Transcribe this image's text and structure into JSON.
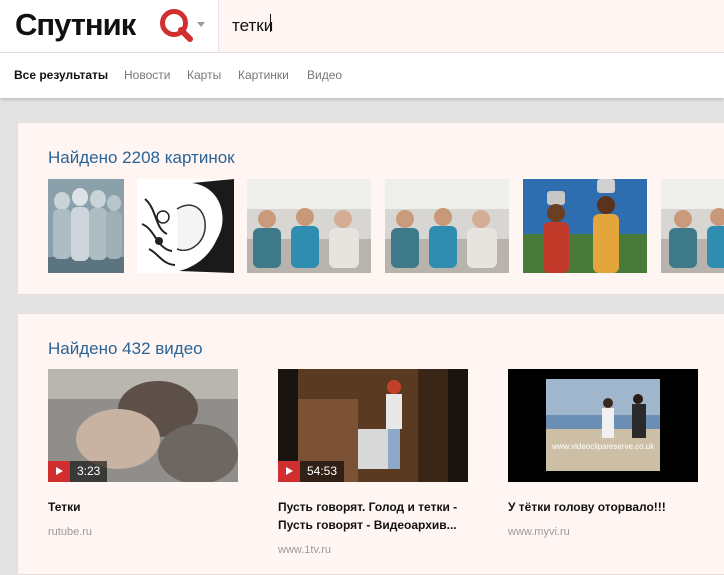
{
  "header": {
    "logo_text": "Спутник",
    "search_value": "тетки"
  },
  "nav": {
    "items": [
      {
        "label": "Все результаты",
        "active": true
      },
      {
        "label": "Новости"
      },
      {
        "label": "Карты"
      },
      {
        "label": "Картинки"
      },
      {
        "label": "Видео"
      }
    ]
  },
  "images_section": {
    "title": "Найдено 2208 картинок",
    "thumbnails": [
      {
        "subject": "sculpture of figures"
      },
      {
        "subject": "ink drawing of a face"
      },
      {
        "subject": "three women on a sofa"
      },
      {
        "subject": "three women on a sofa"
      },
      {
        "subject": "women carrying water pots"
      },
      {
        "subject": "three women on a sofa"
      }
    ]
  },
  "videos_section": {
    "title": "Найдено 432 видео",
    "videos": [
      {
        "duration": "3:23",
        "title": "Тетки",
        "source": "rutube.ru"
      },
      {
        "duration": "54:53",
        "title": "Пусть говорят. Голод и тетки - Пусть говорят - Видеоархив...",
        "source": "www.1tv.ru"
      },
      {
        "duration": "",
        "title": "У тётки голову оторвало!!!",
        "source": "www.myvi.ru",
        "watermark": "www.videoclipsreserve.co.uk"
      }
    ]
  },
  "colors": {
    "accent_link": "#2a6496",
    "logo_red": "#d12f2f",
    "card_bg": "#fff5f3",
    "page_bg": "#e3e3e3"
  }
}
